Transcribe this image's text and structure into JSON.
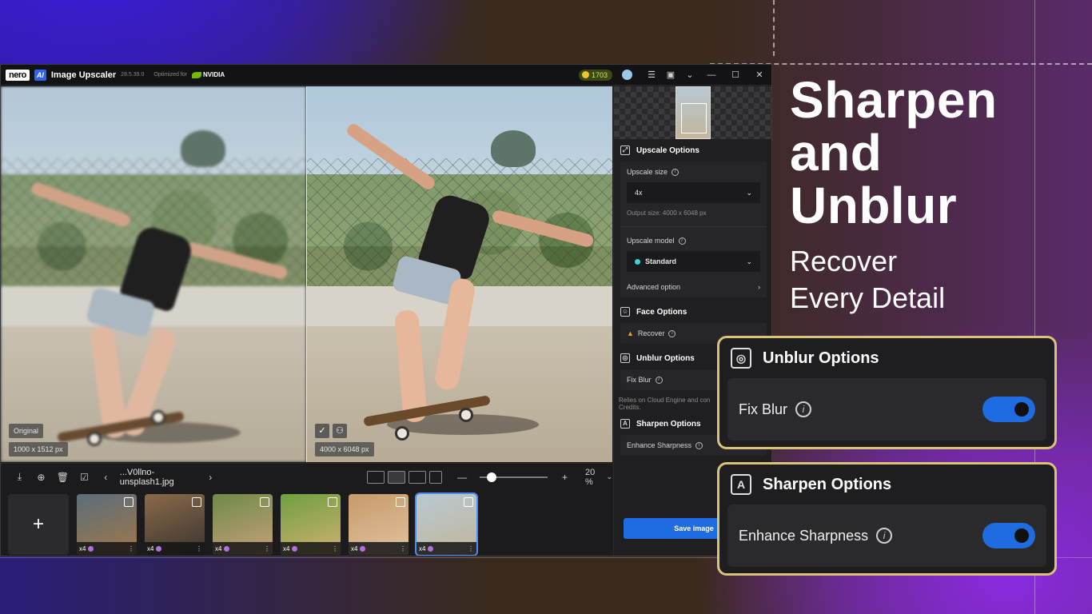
{
  "app": {
    "brand_nero": "nero",
    "brand_ai": "AI",
    "title": "Image Upscaler",
    "version": "28.5.39.0",
    "optimized_for": "Optimized for",
    "nvidia": "NVIDIA",
    "credits": "1703"
  },
  "preview": {
    "left_label": "Original",
    "left_size": "1000 x 1512 px",
    "right_size": "4000 x 6048 px"
  },
  "toolbar": {
    "filename": "...V0llno-unsplash1.jpg",
    "zoom_value": "20 %",
    "zoom_level": 0.1
  },
  "thumbnails": [
    {
      "scale": "x4",
      "colors": [
        "#5b6d7a",
        "#a0784a"
      ]
    },
    {
      "scale": "x4",
      "colors": [
        "#8a6a48",
        "#3a3430"
      ]
    },
    {
      "scale": "x4",
      "colors": [
        "#6f8a4a",
        "#c7a07a"
      ]
    },
    {
      "scale": "x4",
      "colors": [
        "#6fa040",
        "#d0b070"
      ]
    },
    {
      "scale": "x4",
      "colors": [
        "#c89a6a",
        "#e0c2a0"
      ]
    },
    {
      "scale": "x4",
      "colors": [
        "#b8c9d2",
        "#c2b59a"
      ],
      "selected": true
    }
  ],
  "right_panel": {
    "upscale_options": "Upscale Options",
    "upscale_size_label": "Upscale size",
    "upscale_size_value": "4x",
    "output_size": "Output size: 4000 x 6048 px",
    "upscale_model_label": "Upscale model",
    "upscale_model_value": "Standard",
    "advanced_option": "Advanced option",
    "face_options": "Face Options",
    "recover": "Recover",
    "unblur_options": "Unblur Options",
    "fix_blur": "Fix Blur",
    "cloud_note": "Relies on Cloud Engine and con",
    "cloud_note2": "Credits.",
    "sharpen_options": "Sharpen Options",
    "enhance_sharpness": "Enhance Sharpness",
    "save_image": "Save image"
  },
  "headline": {
    "line1": "Sharpen",
    "line2": "and",
    "line3": "Unblur",
    "sub1": "Recover",
    "sub2": "Every Detail"
  },
  "callouts": {
    "unblur_title": "Unblur Options",
    "unblur_item": "Fix Blur",
    "unblur_enabled": true,
    "sharpen_title": "Sharpen Options",
    "sharpen_item": "Enhance Sharpness",
    "sharpen_enabled": true
  },
  "colors": {
    "accent": "#1f6be0",
    "callout_border": "#d9c27a",
    "credits_bg": "#3b4a15"
  },
  "icons": [
    "download-icon",
    "add-icon",
    "trash-icon",
    "check-square-icon",
    "chevron-left-icon",
    "chevron-right-icon",
    "minimize-icon",
    "maximize-icon",
    "close-icon",
    "sliders-icon",
    "gift-icon",
    "chevron-down-icon",
    "info-icon",
    "warning-icon",
    "face-scan-icon",
    "sharpen-icon",
    "upscale-icon"
  ]
}
